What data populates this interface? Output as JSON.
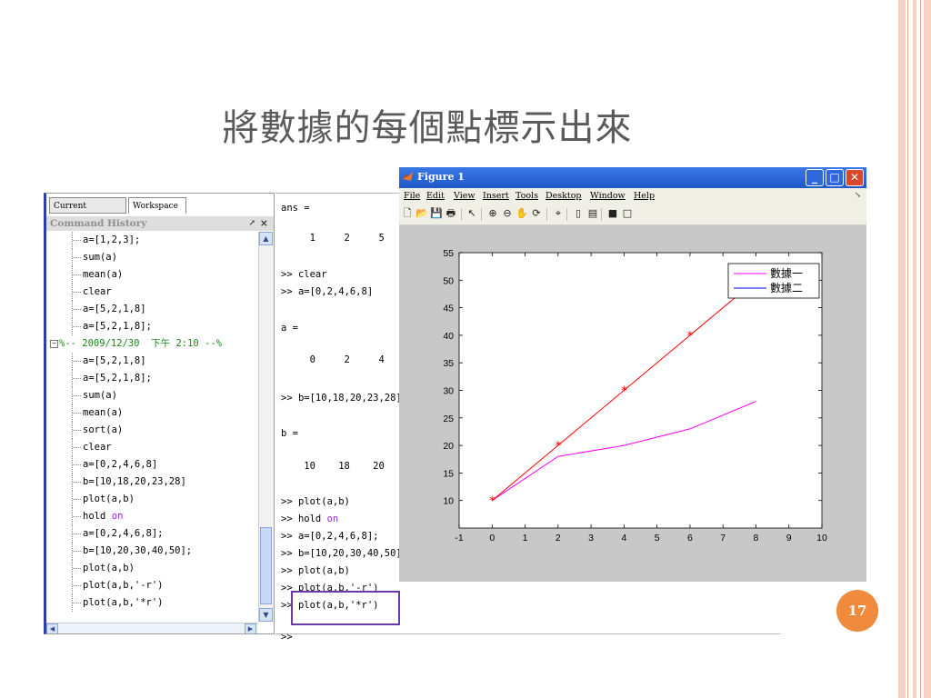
{
  "slide": {
    "title": "將數據的每個點標示出來",
    "page_number": "17"
  },
  "left_panel": {
    "tab_current_directory": "Current Directory",
    "tab_workspace": "Workspace",
    "history_header": "Command History",
    "pin_glyph": "↗",
    "close_glyph": "×",
    "history": [
      {
        "text": "a=[1,2,3];"
      },
      {
        "text": "sum(a)"
      },
      {
        "text": "mean(a)"
      },
      {
        "text": "clear"
      },
      {
        "text": "a=[5,2,1,8]"
      },
      {
        "text": "a=[5,2,1,8];"
      },
      {
        "text": "%-- 2009/12/30  下午 2:10 --%",
        "session": true
      },
      {
        "text": "a=[5,2,1,8]"
      },
      {
        "text": "a=[5,2,1,8];"
      },
      {
        "text": "sum(a)"
      },
      {
        "text": "mean(a)"
      },
      {
        "text": "sort(a)"
      },
      {
        "text": "clear"
      },
      {
        "text": "a=[0,2,4,6,8]"
      },
      {
        "text": "b=[10,18,20,23,28]"
      },
      {
        "text": "plot(a,b)"
      },
      {
        "text": "hold ",
        "kw": "on"
      },
      {
        "text": "a=[0,2,4,6,8];"
      },
      {
        "text": "b=[10,20,30,40,50];"
      },
      {
        "text": "plot(a,b)"
      },
      {
        "text": "plot(a,b,'-r')"
      },
      {
        "text": "plot(a,b,'*r')"
      }
    ]
  },
  "command_window": {
    "lines": [
      {
        "text": "ans ="
      },
      {
        "text": "     1     2     5"
      },
      {
        "text": ">> clear"
      },
      {
        "text": ">> a=[0,2,4,6,8]"
      },
      {
        "text": "a ="
      },
      {
        "text": "     0     2     4"
      },
      {
        "text": ">> b=[10,18,20,23,28]"
      },
      {
        "text": "b ="
      },
      {
        "text": "    10    18    20"
      },
      {
        "text": ">> plot(a,b)"
      },
      {
        "text": ">> hold ",
        "kw": "on"
      },
      {
        "text": ">> a=[0,2,4,6,8];"
      },
      {
        "text": ">> b=[10,20,30,40,50]"
      },
      {
        "text": ">> plot(a,b)"
      },
      {
        "text": ">> plot(a,b,'-r')"
      },
      {
        "text": ">> plot(a,b,'*r')"
      },
      {
        "text": ">>"
      }
    ]
  },
  "figure_window": {
    "title": "Figure 1",
    "menu": [
      "File",
      "Edit",
      "View",
      "Insert",
      "Tools",
      "Desktop",
      "Window",
      "Help"
    ],
    "min_glyph": "_",
    "max_glyph": "□",
    "close_glyph": "✕",
    "menu_end_glyph": "↘",
    "toolbar_icons": [
      {
        "name": "new-figure-icon",
        "glyph": "🗋"
      },
      {
        "name": "open-file-icon",
        "glyph": "📂"
      },
      {
        "name": "save-icon",
        "glyph": "💾"
      },
      {
        "name": "print-icon",
        "glyph": "🖶"
      },
      {
        "name": "edit-plot-icon",
        "glyph": "↖"
      },
      {
        "name": "zoom-in-icon",
        "glyph": "⊕"
      },
      {
        "name": "zoom-out-icon",
        "glyph": "⊖"
      },
      {
        "name": "pan-icon",
        "glyph": "✋"
      },
      {
        "name": "rotate-3d-icon",
        "glyph": "⟳"
      },
      {
        "name": "data-cursor-icon",
        "glyph": "⌖"
      },
      {
        "name": "colorbar-icon",
        "glyph": "▯"
      },
      {
        "name": "legend-icon",
        "glyph": "▤"
      },
      {
        "name": "hide-plot-tools-icon",
        "glyph": "■"
      },
      {
        "name": "show-plot-tools-icon",
        "glyph": "□"
      }
    ]
  },
  "chart_data": {
    "type": "line",
    "xlim": [
      -1,
      10
    ],
    "ylim": [
      5,
      55
    ],
    "xticks": [
      -1,
      0,
      1,
      2,
      3,
      4,
      5,
      6,
      7,
      8,
      9,
      10
    ],
    "yticks": [
      10,
      15,
      20,
      25,
      30,
      35,
      40,
      45,
      50,
      55
    ],
    "legend_position": "top-right",
    "grid": false,
    "series": [
      {
        "name": "數據一",
        "color": "#ff00ff",
        "x": [
          0,
          2,
          4,
          6,
          8
        ],
        "y": [
          10,
          18,
          20,
          23,
          28
        ],
        "marker": "none"
      },
      {
        "name": "數據二",
        "color": "#0000ff",
        "x": [
          0,
          2,
          4,
          6,
          8
        ],
        "y": [
          10,
          20,
          30,
          40,
          50
        ],
        "marker": "none",
        "legend_only": true
      }
    ],
    "red_line": {
      "color": "#ff0000",
      "x": [
        0,
        2,
        4,
        6,
        8
      ],
      "y": [
        10,
        20,
        30,
        40,
        50
      ],
      "marker": "*"
    }
  }
}
